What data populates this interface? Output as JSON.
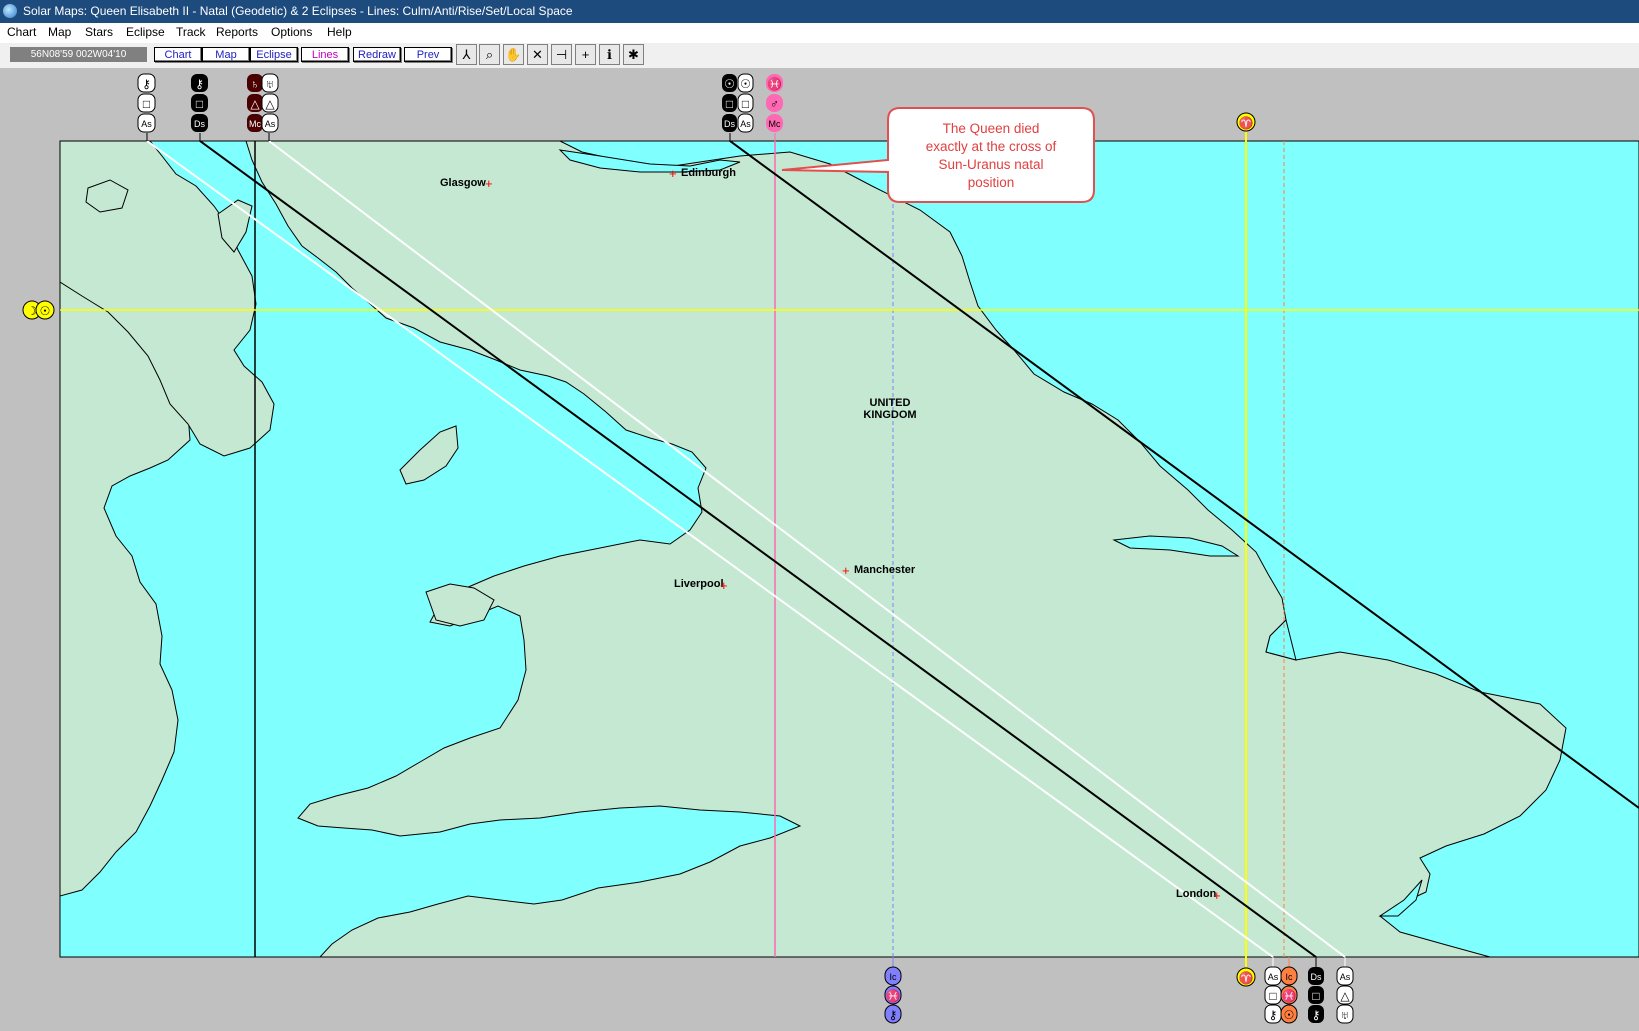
{
  "window": {
    "title": "Solar Maps: Queen Elisabeth II - Natal (Geodetic)  & 2 Eclipses - Lines: Culm/Anti/Rise/Set/Local Space"
  },
  "menu": [
    "Chart",
    "Map",
    "Stars",
    "Eclipse",
    "Track",
    "Reports",
    "Options",
    "Help"
  ],
  "toolbar": {
    "coordinates": "56N08'59  002W04'10",
    "buttons": [
      "Chart",
      "Map",
      "Eclipse",
      "Lines",
      "Redraw",
      "Prev"
    ],
    "active_button": "Lines",
    "tools": [
      "move-tool-icon",
      "zoom-tool-icon",
      "hand-tool-icon",
      "cross-tool-icon",
      "probe-tool-icon",
      "add-point-tool-icon",
      "info-tool-icon",
      "aspect-tool-icon"
    ]
  },
  "map": {
    "cities": [
      "Glasgow",
      "Edinburgh",
      "Manchester",
      "Liverpool",
      "London"
    ],
    "country": [
      "UNITED",
      "KINGDOM"
    ],
    "colors": {
      "sea": "#80ffff",
      "land": "#c4e8d2",
      "natal": "#000000",
      "eclipse_white": "#ffffff",
      "sun": "#ffff00",
      "mars": "#ff69b4",
      "blue": "#8080ff",
      "orange": "#ff8040"
    }
  },
  "callout": {
    "lines": [
      "The Queen died",
      "exactly at the cross of",
      "Sun-Uranus natal",
      "position"
    ]
  },
  "glyphs": {
    "chiron": "⚷",
    "uranus": "♅",
    "saturn": "♄",
    "sun": "☉",
    "moon": "☽",
    "mars": "♂",
    "pisces": "♓",
    "aries": "♈",
    "trine": "△",
    "square": "□",
    "ascendant": "As",
    "descendant": "Ds",
    "midheaven": "Mc",
    "ic": "Ic"
  }
}
